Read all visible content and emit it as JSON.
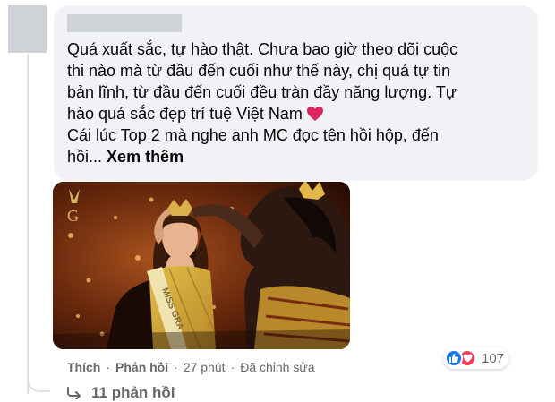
{
  "comment": {
    "lines": [
      "Quá xuất sắc, tự hào thật. Chưa bao giờ theo dõi cuộc",
      "thi nào mà từ đầu đến cuối như thế này, chị quá tự tin",
      "bản lĩnh, từ đầu đến cuối đều tràn đầy năng lượng. Tự",
      "hào quá sắc đẹp trí tuệ Việt Nam",
      "Cái lúc Top 2 mà nghe anh MC đọc tên hồi hộp, đến",
      "hồi..."
    ],
    "see_more": "Xem thêm"
  },
  "photo": {
    "sash_text": "MISS GRA"
  },
  "actions": {
    "like": "Thích",
    "reply": "Phản hồi",
    "time": "27 phút",
    "edited": "Đã chỉnh sửa",
    "separator": "·"
  },
  "reactions": {
    "icons": [
      "like-icon",
      "love-icon"
    ],
    "count": "107"
  },
  "replies": {
    "label": "11 phản hồi"
  },
  "colors": {
    "like": "#1877f2",
    "love": "#f33e58",
    "bubble": "#f0f2f5",
    "secondary_text": "#65676b"
  }
}
